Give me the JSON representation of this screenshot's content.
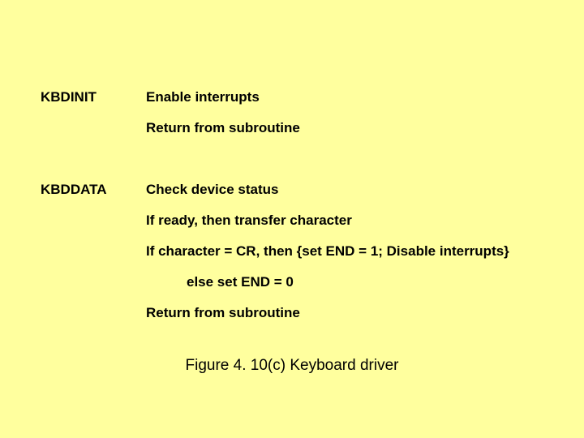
{
  "routines": [
    {
      "name": "KBDINIT",
      "lines": [
        {
          "text": "Enable interrupts",
          "indent": false
        },
        {
          "text": "Return from subroutine",
          "indent": false
        }
      ]
    },
    {
      "name": "KBDDATA",
      "lines": [
        {
          "text": "Check device status",
          "indent": false
        },
        {
          "text": "If ready, then transfer character",
          "indent": false
        },
        {
          "text": "If character = CR, then {set END = 1;  Disable interrupts}",
          "indent": false
        },
        {
          "text": "else set END = 0",
          "indent": true
        },
        {
          "text": "Return from subroutine",
          "indent": false
        }
      ]
    }
  ],
  "caption": "Figure 4. 10(c)  Keyboard driver"
}
